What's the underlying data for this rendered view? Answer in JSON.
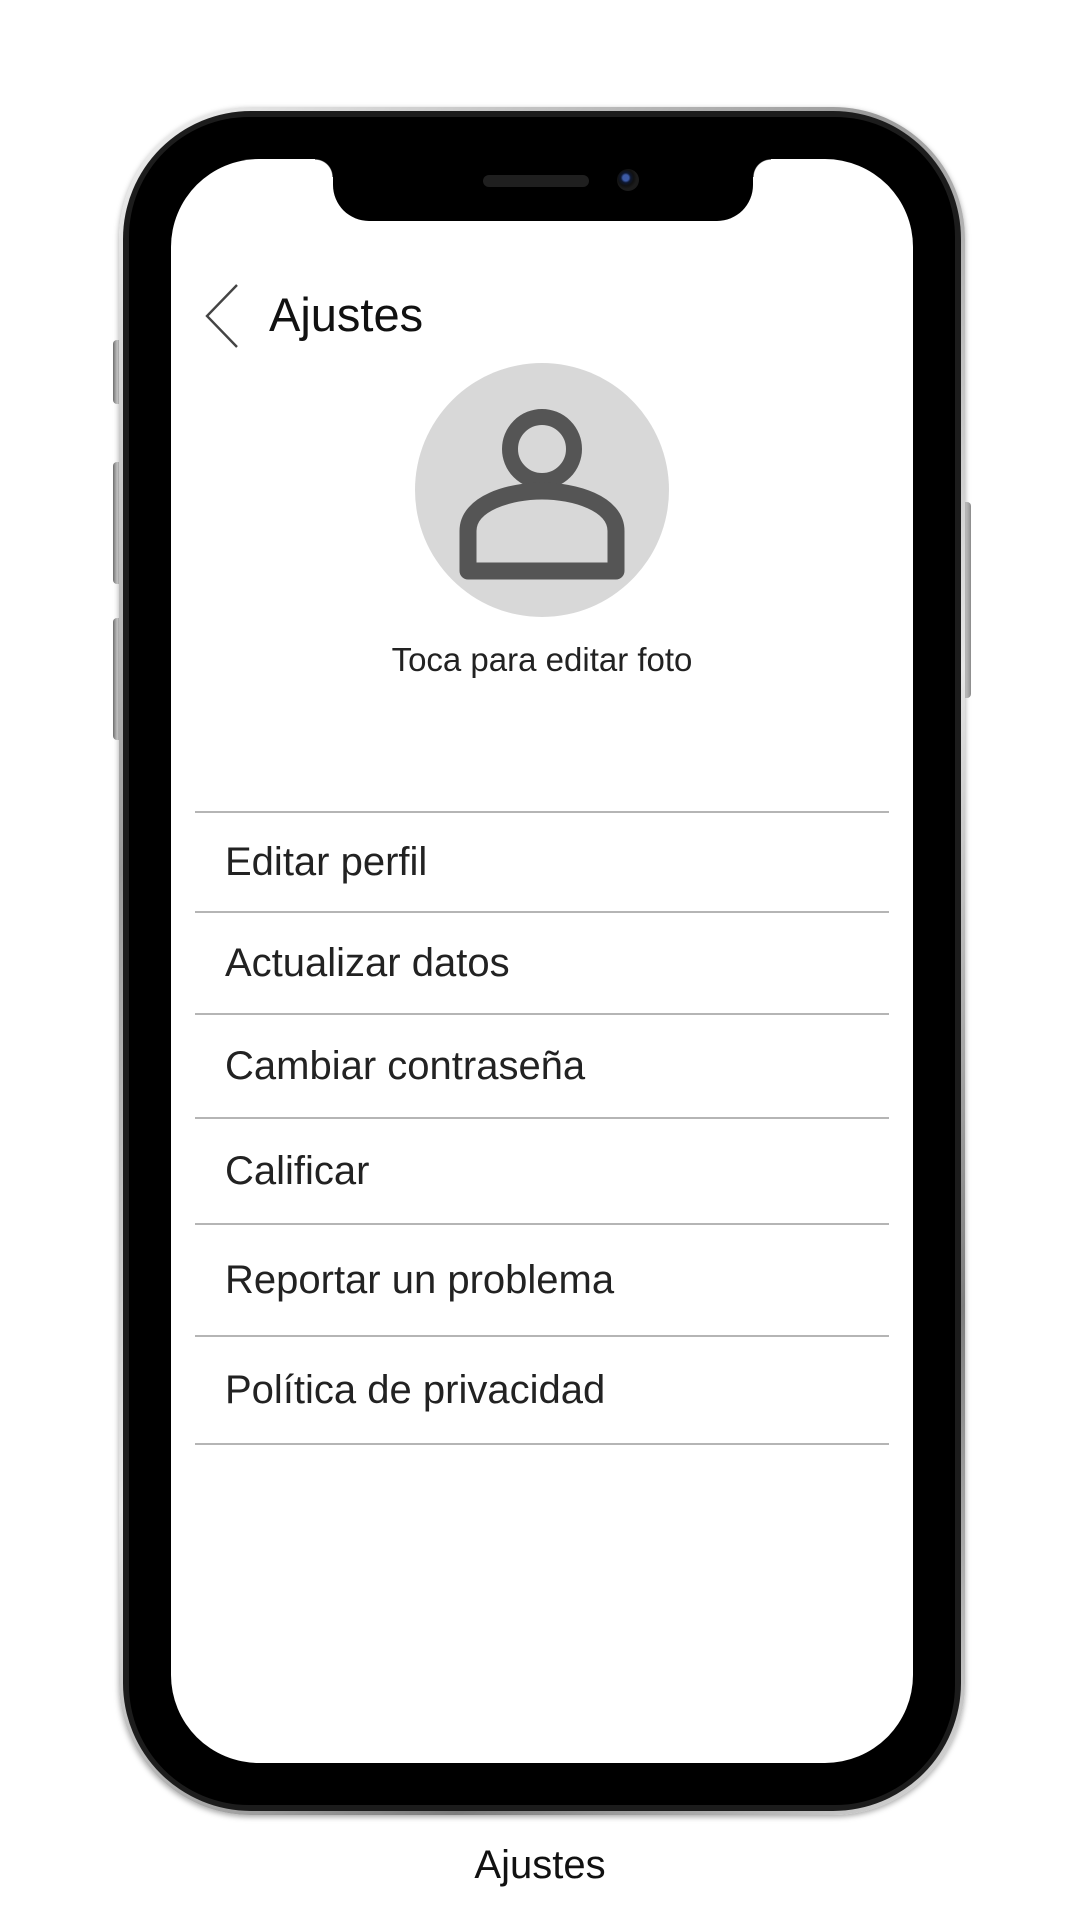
{
  "header": {
    "title": "Ajustes",
    "back_icon": "chevron-left-icon"
  },
  "profile": {
    "avatar_icon": "person-icon",
    "edit_photo_label": "Toca para editar foto"
  },
  "menu": {
    "items": [
      {
        "label": "Editar perfil"
      },
      {
        "label": "Actualizar datos"
      },
      {
        "label": "Cambiar contraseña"
      },
      {
        "label": "Calificar"
      },
      {
        "label": "Reportar un problema"
      },
      {
        "label": "Política de privacidad"
      }
    ]
  },
  "caption": "Ajustes",
  "colors": {
    "avatar_background": "#d8d8d8",
    "avatar_icon": "#555555",
    "divider": "#b5b5b5",
    "text": "#222222"
  }
}
